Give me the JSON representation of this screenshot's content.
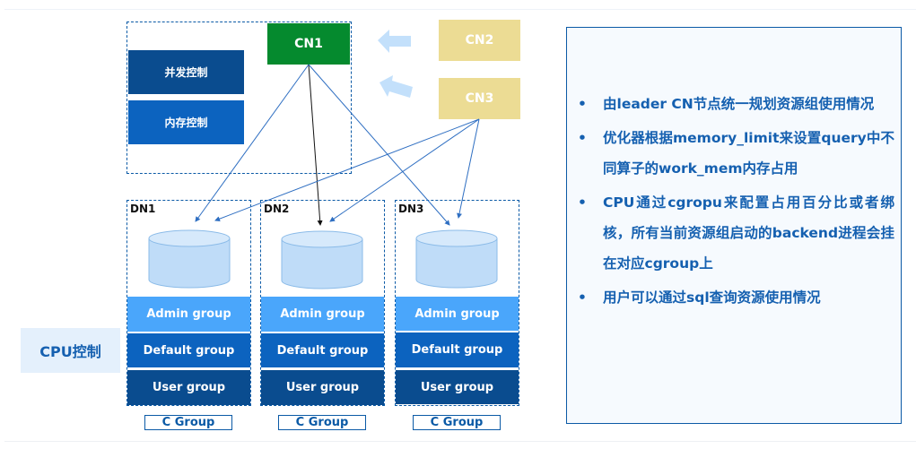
{
  "control_node": {
    "cn1": "CN1",
    "cn2": "CN2",
    "cn3": "CN3",
    "concurrency_control": "并发控制",
    "memory_control": "内存控制"
  },
  "data_nodes": [
    {
      "label": "DN1",
      "groups": [
        "Admin group",
        "Default group",
        "User group"
      ],
      "cgroup_label": "C Group"
    },
    {
      "label": "DN2",
      "groups": [
        "Admin group",
        "Default group",
        "User group"
      ],
      "cgroup_label": "C Group"
    },
    {
      "label": "DN3",
      "groups": [
        "Admin group",
        "Default group",
        "User group"
      ],
      "cgroup_label": "C Group"
    }
  ],
  "cpu_control": "CPU控制",
  "colors": {
    "cn1": "#058a2e",
    "cn_secondary": "#ecdc94",
    "concurrency": "#0a4c8f",
    "memory": "#0c63bf",
    "admin_group": "#4aa6fb",
    "default_group": "#0c63bf",
    "user_group": "#0a4c8f",
    "text_accent": "#1560b0"
  },
  "panel": {
    "bullet_glyph": "•",
    "bullets": [
      "由leader CN节点统一规划资源组使用情况",
      "优化器根据memory_limit来设置query中不同算子的work_mem内存占用",
      "CPU通过cgropu来配置占用百分比或者绑核，所有当前资源组启动的backend进程会挂在对应cgroup上",
      "用户可以通过sql查询资源使用情况"
    ]
  }
}
